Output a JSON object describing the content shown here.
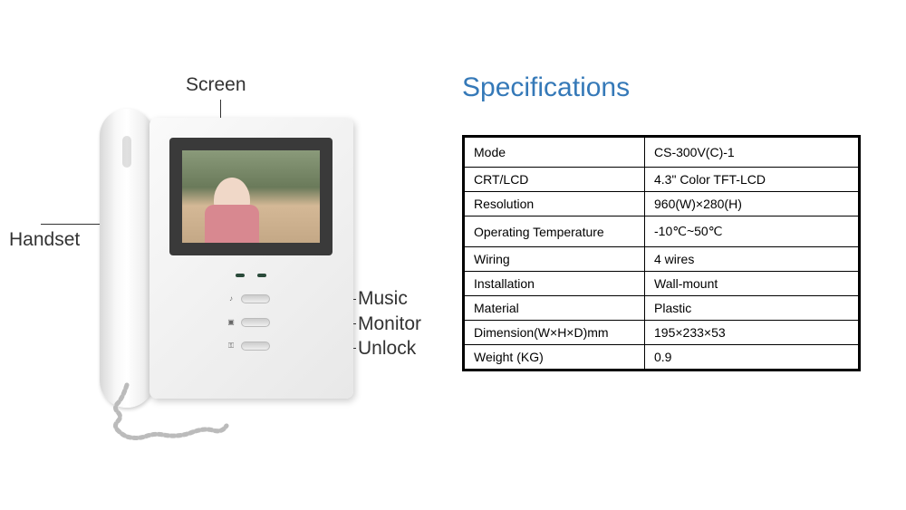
{
  "title": "Specifications",
  "labels": {
    "screen": "Screen",
    "handset": "Handset",
    "music": "Music",
    "monitor": "Monitor",
    "unlock": "Unlock"
  },
  "specs": [
    {
      "name": "Mode",
      "value": "CS-300V(C)-1"
    },
    {
      "name": "CRT/LCD",
      "value": "4.3\" Color TFT-LCD"
    },
    {
      "name": "Resolution",
      "value": "960(W)×280(H)"
    },
    {
      "name": "Operating Temperature",
      "value": "-10℃~50℃"
    },
    {
      "name": "Wiring",
      "value": "4 wires"
    },
    {
      "name": "Installation",
      "value": "Wall-mount"
    },
    {
      "name": "Material",
      "value": "Plastic"
    },
    {
      "name": "Dimension(W×H×D)mm",
      "value": "195×233×53"
    },
    {
      "name": "Weight (KG)",
      "value": "0.9"
    }
  ]
}
